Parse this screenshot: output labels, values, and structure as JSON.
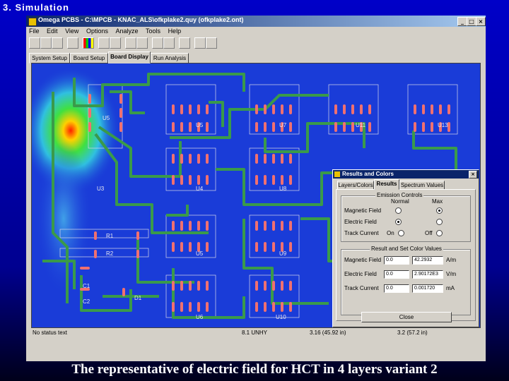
{
  "slide": {
    "title": "3. Simulation",
    "caption": "The representative of electric field for HCT in 4 layers variant 2"
  },
  "window": {
    "title": "Omega PCBS - C:\\MPCB - KNAC_ALS\\ofkplake2.quy (ofkplake2.ont)",
    "buttons": [
      "_",
      "□",
      "×"
    ]
  },
  "menu": [
    "File",
    "Edit",
    "View",
    "Options",
    "Analyze",
    "Tools",
    "Help"
  ],
  "tabs": [
    {
      "label": "System Setup",
      "active": false
    },
    {
      "label": "Board Setup",
      "active": false
    },
    {
      "label": "Board Display",
      "active": true
    },
    {
      "label": "Run Analysis",
      "active": false
    }
  ],
  "board": {
    "components": [
      "U5",
      "U7",
      "U11",
      "U13",
      "U3",
      "U4",
      "U8",
      "U5",
      "U9",
      "R1",
      "R2",
      "C1",
      "C2",
      "D1",
      "U6",
      "U10"
    ],
    "colors": {
      "background": "#1a3cd8",
      "trace": "#3a9a4a",
      "pad": "#f07070",
      "outline": "#d8d8e8"
    }
  },
  "status": {
    "left": "No status text",
    "mid": "8.1 UNHY",
    "mid2": "3.16 (45.92 in)",
    "right": "3.2 (57.2 in)"
  },
  "dialog": {
    "title": "Results and Colors",
    "tabs": [
      {
        "label": "Layers/Colors",
        "active": false
      },
      {
        "label": "Results",
        "active": true
      },
      {
        "label": "Spectrum Values",
        "active": false
      }
    ],
    "emission_group": {
      "title": "Emission Controls",
      "col_headers": [
        "Normal",
        "Max"
      ],
      "rows": [
        {
          "label": "Magnetic Field",
          "normal": false,
          "max": true
        },
        {
          "label": "Electric Field",
          "normal": true,
          "max": false
        },
        {
          "label": "Track Current",
          "normal": false,
          "max": false
        }
      ],
      "toggle_labels": [
        "On",
        "Off"
      ]
    },
    "values_group": {
      "title": "Result and Set Color Values",
      "rows": [
        {
          "label": "Magnetic Field",
          "min": "0.0",
          "max": "42.2932",
          "unit": "A/m"
        },
        {
          "label": "Electric Field",
          "min": "0.0",
          "max": "2.90172E3",
          "unit": "V/m"
        },
        {
          "label": "Track Current",
          "min": "0.0",
          "max": "0.001720",
          "unit": "mA"
        }
      ]
    },
    "close_label": "Close"
  }
}
